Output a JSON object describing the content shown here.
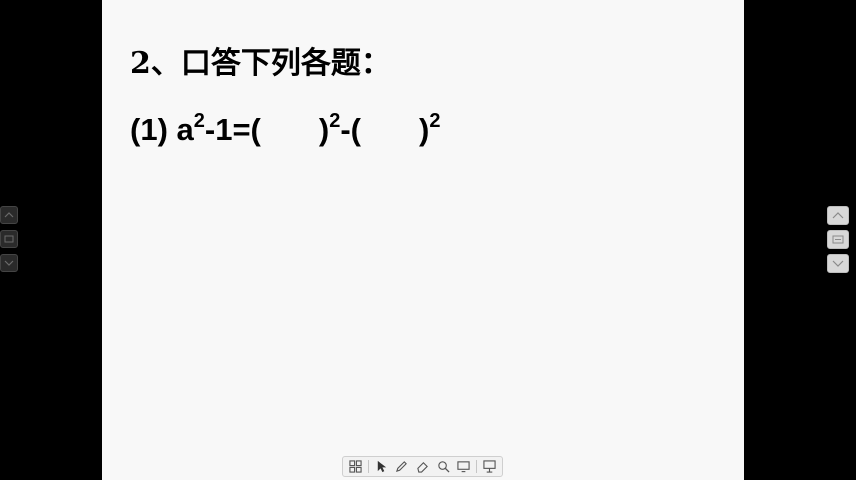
{
  "slide": {
    "title": "2、口答下列各题：",
    "equation": {
      "prefix": "(1) a",
      "exp1": "2",
      "part2": "-1=(",
      "part3": ")",
      "exp2": "2",
      "part4": "-(",
      "part5": ")",
      "exp3": "2"
    }
  },
  "left_controls": {
    "labels": [
      "",
      "",
      ""
    ]
  },
  "right_controls": {
    "labels": [
      "",
      "",
      ""
    ],
    "icons": [
      "chevron-up-icon",
      "page-list-icon",
      "chevron-down-icon"
    ]
  },
  "toolbar": {
    "tools": [
      "grid-icon",
      "pointer-icon",
      "pen-icon",
      "eraser-icon",
      "zoom-icon",
      "screen-icon",
      "presentation-icon"
    ]
  },
  "colors": {
    "background": "#000000",
    "slide": "#f8f8f8",
    "text": "#000000"
  }
}
